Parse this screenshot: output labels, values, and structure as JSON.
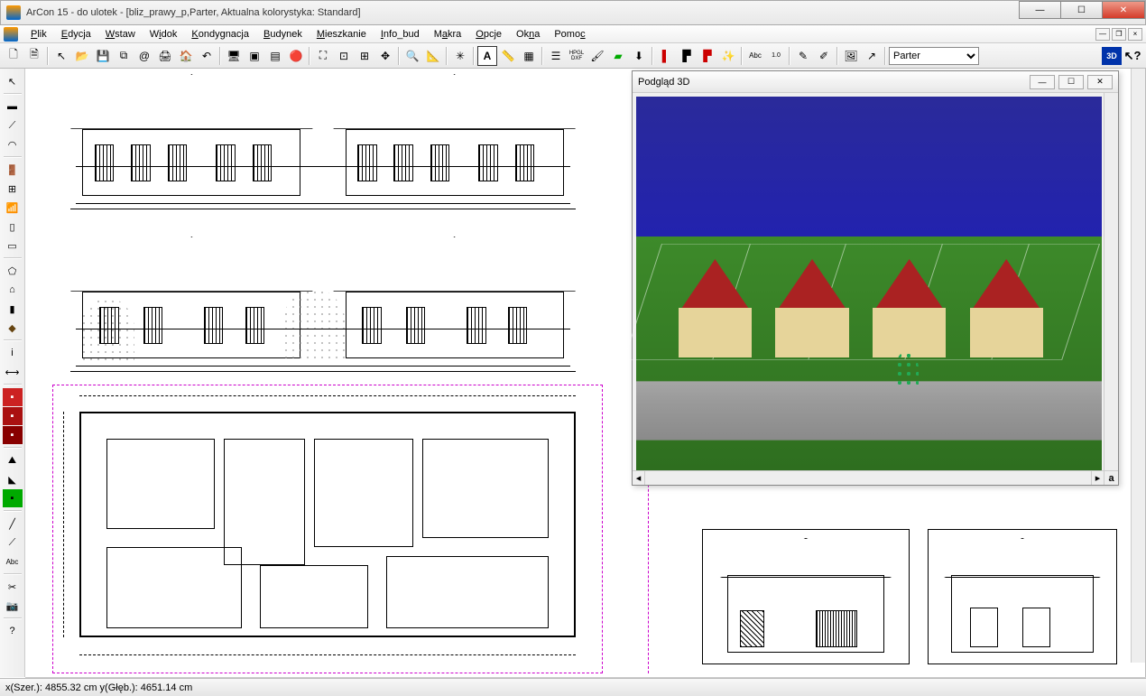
{
  "window": {
    "title": "ArCon 15 - do ulotek - [bliz_prawy_p,Parter, Aktualna kolorystyka: Standard]"
  },
  "menu": {
    "items": [
      "Plik",
      "Edycja",
      "Wstaw",
      "Widok",
      "Kondygnacja",
      "Budynek",
      "Mieszkanie",
      "Info_bud",
      "Makra",
      "Opcje",
      "Okna",
      "Pomoc"
    ]
  },
  "toolbar": {
    "floor_selector": "Parter",
    "btn_3d": "3D"
  },
  "preview": {
    "title": "Podgląd 3D",
    "corner_label": "a"
  },
  "statusbar": {
    "coords": "x(Szer.): 4855.32 cm   y(Głęb.): 4651.14 cm"
  }
}
